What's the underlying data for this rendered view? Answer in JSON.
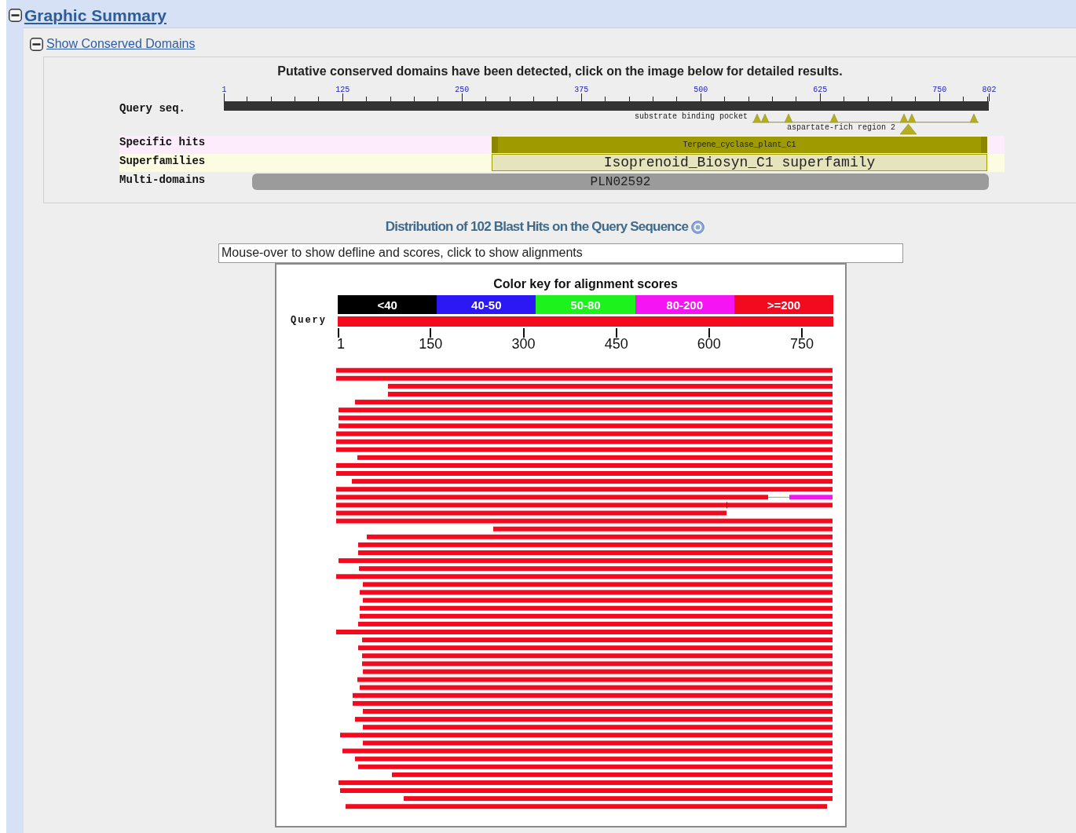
{
  "header": {
    "title": "Graphic Summary",
    "expanded": true
  },
  "conserved_domains": {
    "toggle": "Show Conserved Domains",
    "expanded": true,
    "message": "Putative conserved domains have been detected, click on the image below for detailed results.",
    "ruler_labels": [
      "1",
      "125",
      "250",
      "375",
      "500",
      "625",
      "750",
      "802"
    ],
    "track_labels": [
      "Query seq.",
      "Specific hits",
      "Superfamilies",
      "Multi-domains"
    ],
    "features": [
      {
        "label": "substrate binding pocket"
      },
      {
        "label": "aspartate-rich region 2"
      }
    ],
    "specific_hit": "Terpene_cyclase_plant_C1",
    "superfamily": "Isoprenoid_Biosyn_C1 superfamily",
    "multi_domain": "PLN02592"
  },
  "blast_hits": {
    "title": "Distribution of 102 Blast Hits on the Query Sequence",
    "info_field": "Mouse-over to show defline and scores, click to show alignments",
    "color_key": {
      "title": "Color key for alignment scores",
      "ranges": [
        {
          "label": "<40",
          "color": "#000000"
        },
        {
          "label": "40-50",
          "color": "#2b18f5"
        },
        {
          "label": "50-80",
          "color": "#1df21d"
        },
        {
          "label": "80-200",
          "color": "#f414f4"
        },
        {
          "label": ">=200",
          "color": "#f40a1e"
        }
      ]
    },
    "query_label": "Query",
    "axis_labels": [
      "1",
      "150",
      "300",
      "450",
      "600",
      "750"
    ]
  }
}
